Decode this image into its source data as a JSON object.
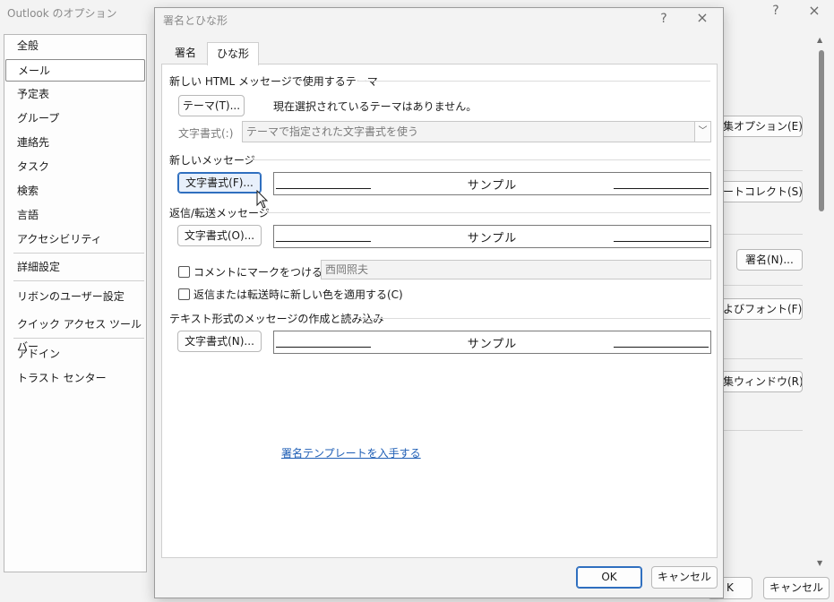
{
  "background_window": {
    "title": "Outlook のオプション",
    "help_icon": "?",
    "close_icon": "×",
    "nav_items": [
      "全般",
      "メール",
      "予定表",
      "グループ",
      "連絡先",
      "タスク",
      "検索",
      "言語",
      "アクセシビリティ",
      "詳細設定",
      "リボンのユーザー設定",
      "クイック アクセス ツール バー",
      "アドイン",
      "トラスト センター"
    ],
    "selected_nav": "メール",
    "right_buttons": [
      "集オプション(E)...",
      "ートコレクト(S)...",
      "署名(N)...",
      "よびフォント(F)...",
      "集ウィンドウ(R)..."
    ],
    "bottom_buttons": [
      "K",
      "キャンセル"
    ]
  },
  "dialog": {
    "title": "署名とひな形",
    "help_icon": "?",
    "close_icon": "×",
    "tabs": [
      "署名",
      "ひな形"
    ],
    "active_tab": "ひな形",
    "theme_section": {
      "label": "新しい HTML メッセージで使用するテーマ",
      "theme_button": "テーマ(T)...",
      "theme_status": "現在選択されているテーマはありません。",
      "font_label": "文字書式(:)",
      "font_combo_value": "テーマで指定された文字書式を使う"
    },
    "new_message": {
      "label": "新しいメッセージ",
      "font_button": "文字書式(F)...",
      "sample_text": "サンプル"
    },
    "reply_forward": {
      "label": "返信/転送メッセージ",
      "font_button": "文字書式(O)...",
      "sample_text": "サンプル",
      "mark_comments_label": "コメントにマークをつける(M):",
      "mark_comments_checked": false,
      "mark_comments_value": "西岡照夫",
      "pick_new_color_label": "返信または転送時に新しい色を適用する(C)",
      "pick_new_color_checked": false
    },
    "plain_text": {
      "label": "テキスト形式のメッセージの作成と読み込み",
      "font_button": "文字書式(N)...",
      "sample_text": "サンプル"
    },
    "link_text": "署名テンプレートを入手する",
    "ok_button": "OK",
    "cancel_button": "キャンセル"
  }
}
